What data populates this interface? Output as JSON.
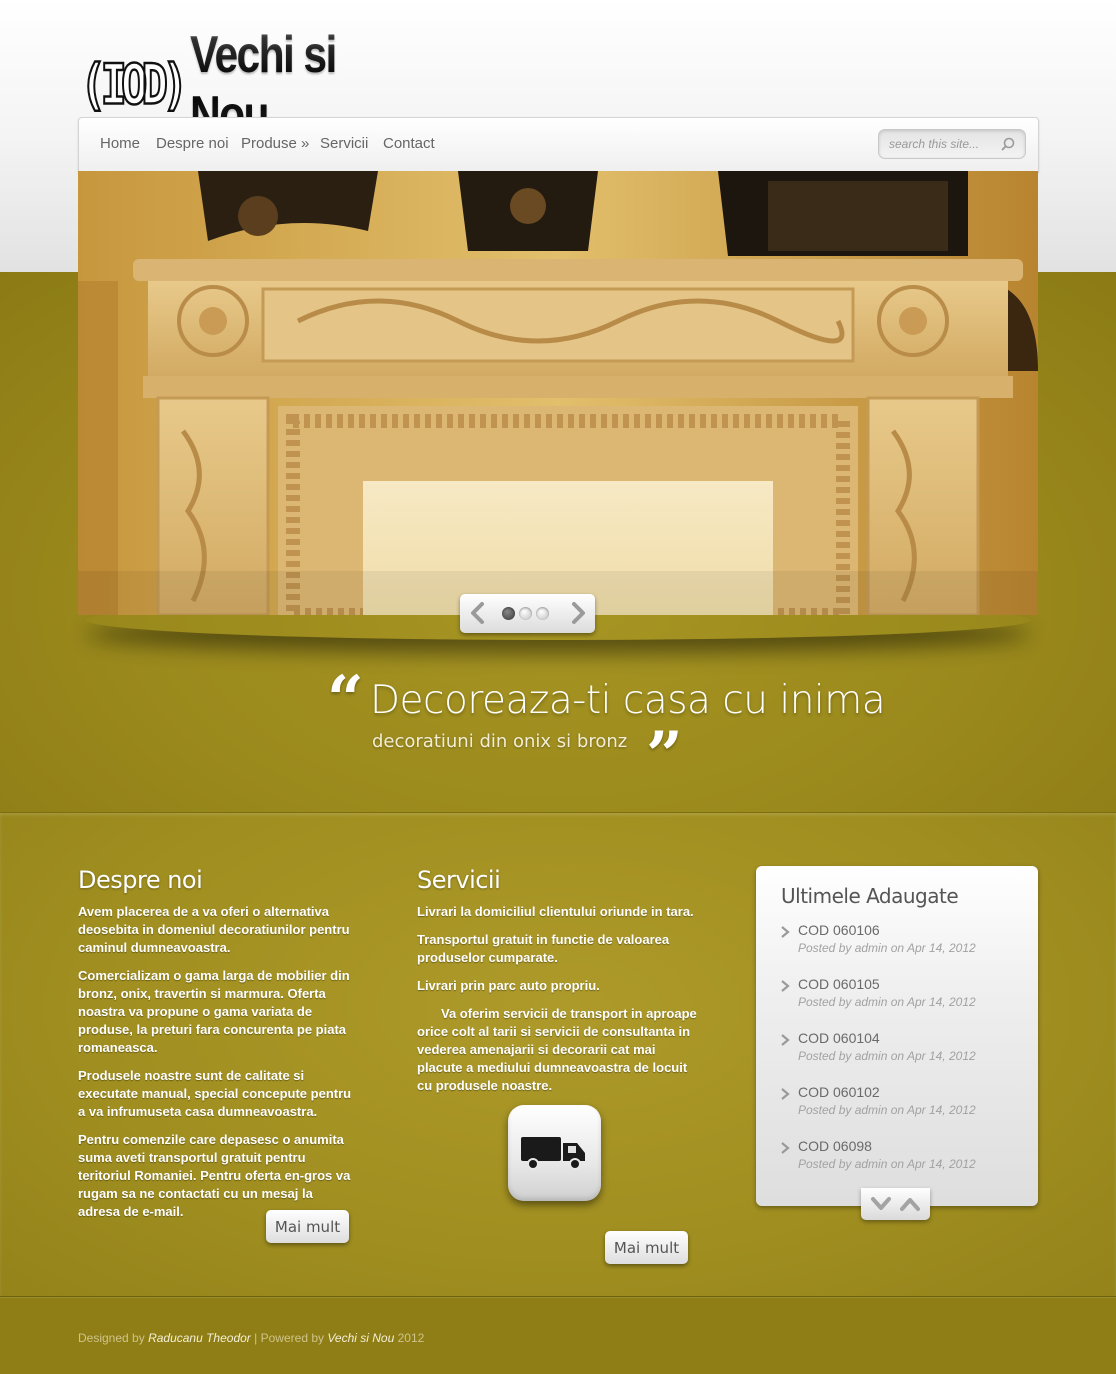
{
  "site": {
    "logo_mark": "(IOD)",
    "name": "Vechi si Nou"
  },
  "nav": {
    "items": [
      "Home",
      "Despre noi",
      "Produse »",
      "Servicii",
      "Contact"
    ],
    "search_placeholder": "search this site..."
  },
  "slider": {
    "slide_count": 3,
    "active_index": 0
  },
  "tagline": {
    "main": "Decoreaza-ti casa cu inima",
    "sub": "decoratiuni din onix si bronz",
    "open_quote": "“",
    "close_quote": "”"
  },
  "about": {
    "title": "Despre noi",
    "paragraphs": [
      "Avem placerea de a va oferi o alternativa deosebita in domeniul decoratiunilor pentru caminul dumneavoastra.",
      "Comercializam o gama larga de mobilier din bronz, onix, travertin si marmura. Oferta noastra va propune o gama variata de produse, la preturi fara concurenta pe piata romaneasca.",
      "Produsele noastre sunt de calitate si executate manual, special concepute pentru a va infrumuseta casa dumneavoastra.",
      "Pentru comenzile care depasesc o anumita suma aveti transportul gratuit pentru teritoriul Romaniei. Pentru oferta en-gros va rugam sa ne contactati cu un mesaj la adresa de e-mail."
    ],
    "more_label": "Mai mult"
  },
  "services": {
    "title": "Servicii",
    "paragraphs": [
      "Livrari la domiciliul clientului oriunde in tara.",
      "Transportul gratuit in functie de valoarea produselor cumparate.",
      "Livrari prin parc auto propriu.",
      "Va oferim servicii de transport in aproape orice colt al tarii si servicii de consultanta in vederea amenajarii si decorarii cat mai placute a mediului dumneavoastra de locuit cu produsele noastre."
    ],
    "icon": "truck-icon",
    "more_label": "Mai mult"
  },
  "recent": {
    "title": "Ultimele Adaugate",
    "posts": [
      {
        "title": "COD 060106",
        "meta": "Posted by admin on Apr 14, 2012"
      },
      {
        "title": "COD 060105",
        "meta": "Posted by admin on Apr 14, 2012"
      },
      {
        "title": "COD 060104",
        "meta": "Posted by admin on Apr 14, 2012"
      },
      {
        "title": "COD 060102",
        "meta": "Posted by admin on Apr 14, 2012"
      },
      {
        "title": "COD 06098",
        "meta": "Posted by admin on Apr 14, 2012"
      }
    ]
  },
  "footer": {
    "designed_by_label": "Designed by",
    "designer": "Raducanu Theodor",
    "separator": "|",
    "powered_by_label": "Powered by",
    "powered_by": "Vechi si Nou",
    "year": "2012"
  },
  "colors": {
    "olive_background": "#9b8a1c",
    "nav_text": "#666666",
    "widget_title": "#555555"
  }
}
